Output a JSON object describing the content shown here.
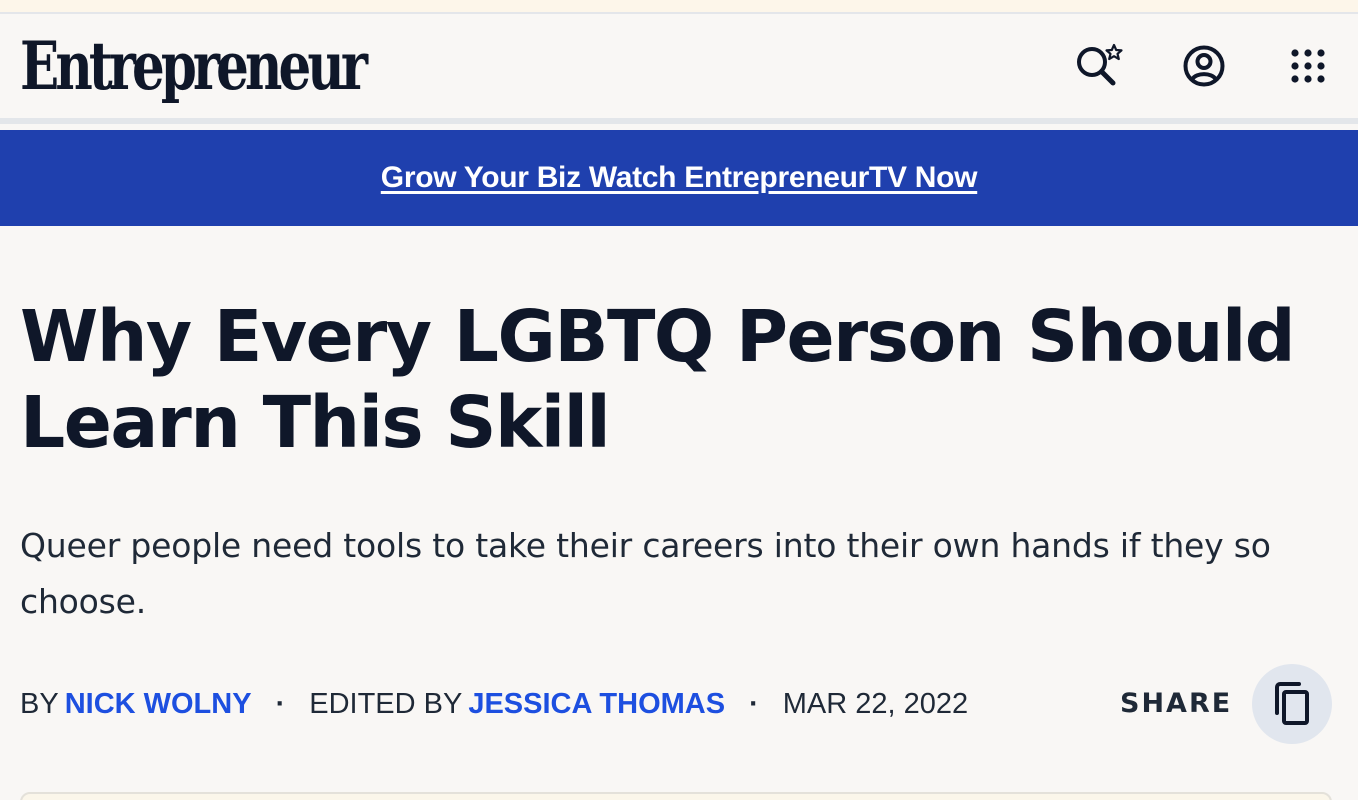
{
  "header": {
    "logo_text": "Entrepreneur",
    "icons": [
      "search-icon",
      "account-icon",
      "apps-menu-icon"
    ]
  },
  "promo": {
    "link_text": "Grow Your Biz Watch EntrepreneurTV Now "
  },
  "article": {
    "headline": "Why Every LGBTQ Person Should Learn This Skill",
    "dek": "Queer people need tools to take their careers into their own hands if they so choose.",
    "byline": {
      "by_label": "BY",
      "author": "NICK WOLNY",
      "separator": "·",
      "edited_label": "EDITED BY",
      "editor": "JESSICA THOMAS",
      "date": "MAR 22, 2022"
    },
    "share_label": "SHARE"
  },
  "colors": {
    "ink": "#0f1729",
    "promo_bg": "#1f40ae",
    "link_blue": "#1d4fe0",
    "page_bg": "#f9f7f5",
    "share_button_bg": "#e1e6ee"
  }
}
